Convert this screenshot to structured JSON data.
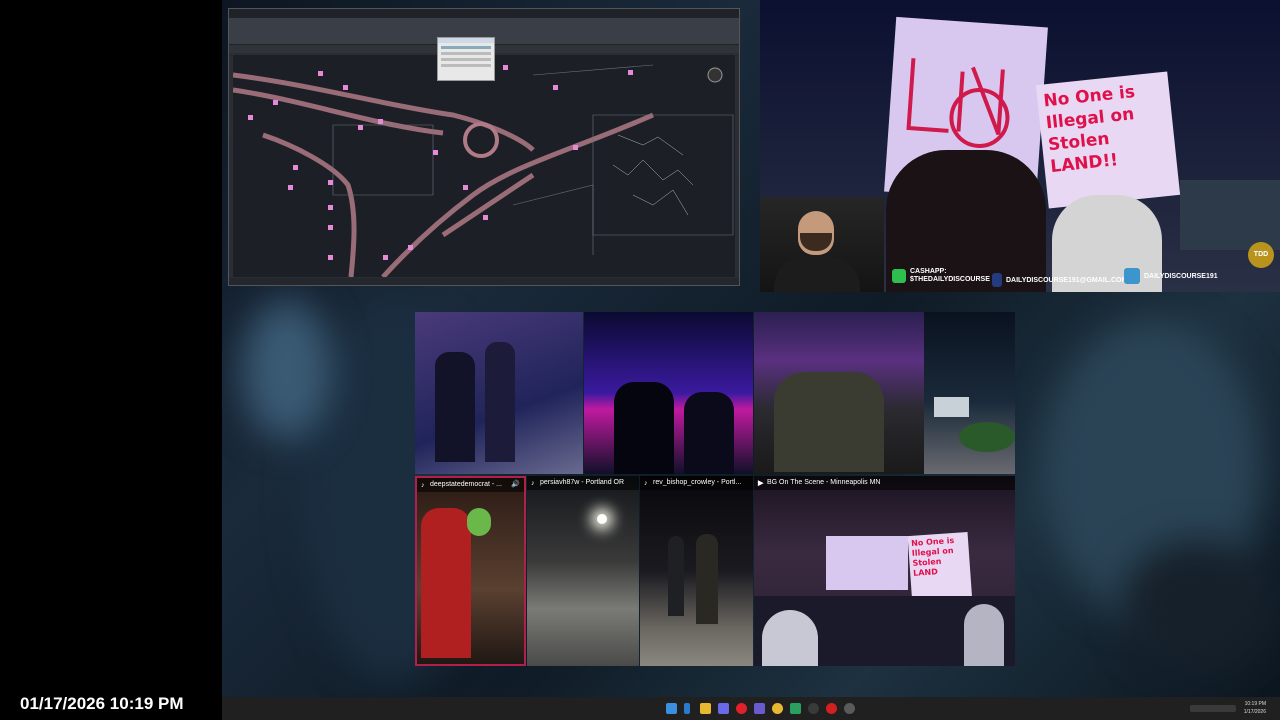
{
  "overlay_datetime": "01/17/2026 10:19 PM",
  "cad_window": {
    "title_text": "",
    "dialog": "properties-dialog"
  },
  "stream": {
    "sign_right_text": "No One is Illegal on Stolen LAND!!",
    "channel_badge": "TDD",
    "cashapp_label": "CASHAPP:",
    "cashapp_handle": "$THEDAILYDISCOURSE",
    "paypal_email": "DAILYDISCOURSE191@GMAIL.COM",
    "venmo_handle": "DAILYDISCOURSE191",
    "icons": [
      "cashapp-icon",
      "paypal-icon",
      "venmo-icon"
    ],
    "colors": {
      "cashapp": "#2ec04f",
      "venmo": "#3d95ce",
      "sign": "#e0104a"
    }
  },
  "video_tiles": [
    {
      "label": ""
    },
    {
      "label": ""
    },
    {
      "label": ""
    },
    {
      "label": ""
    },
    {
      "label": "deepstatedemocrat - ...",
      "platform": "tiktok-icon",
      "audio": "speaker-icon"
    },
    {
      "label": "persiavh87w - Portland OR",
      "platform": "tiktok-icon"
    },
    {
      "label": "rev_bishop_crowley - Portl...",
      "platform": "tiktok-icon"
    },
    {
      "label": "BG On The Scene - Minneapolis MN",
      "platform": "youtube-icon"
    }
  ],
  "tile_sign_text": "No One is Illegal on Stolen LAND",
  "taskbar": {
    "icons": [
      "windows-start-icon",
      "search-icon",
      "file-explorer-icon",
      "discord-icon",
      "opera-icon",
      "teams-icon",
      "chrome-icon",
      "app-icon",
      "obs-icon",
      "youtube-icon",
      "obs-studio-icon"
    ],
    "clock_time": "10:19 PM",
    "clock_date": "1/17/2026"
  }
}
